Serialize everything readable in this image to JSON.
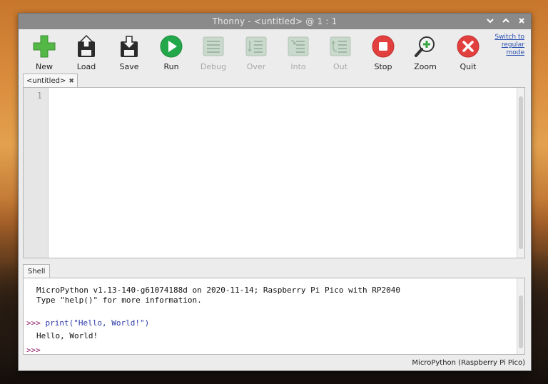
{
  "window": {
    "title": "Thonny  -  <untitled>  @  1 : 1",
    "controls": [
      "minimize",
      "maximize",
      "close"
    ]
  },
  "toolbar": {
    "buttons": [
      {
        "label": "New",
        "icon": "new-file-icon",
        "enabled": true
      },
      {
        "label": "Load",
        "icon": "load-icon",
        "enabled": true
      },
      {
        "label": "Save",
        "icon": "save-icon",
        "enabled": true
      },
      {
        "label": "Run",
        "icon": "run-icon",
        "enabled": true
      },
      {
        "label": "Debug",
        "icon": "debug-icon",
        "enabled": false
      },
      {
        "label": "Over",
        "icon": "step-over-icon",
        "enabled": false
      },
      {
        "label": "Into",
        "icon": "step-into-icon",
        "enabled": false
      },
      {
        "label": "Out",
        "icon": "step-out-icon",
        "enabled": false
      },
      {
        "label": "Stop",
        "icon": "stop-icon",
        "enabled": true
      },
      {
        "label": "Zoom",
        "icon": "zoom-icon",
        "enabled": true
      },
      {
        "label": "Quit",
        "icon": "quit-icon",
        "enabled": true
      }
    ],
    "mode_link": "Switch to\nregular\nmode"
  },
  "editor": {
    "tab_label": "<untitled>",
    "line_numbers": [
      "1"
    ],
    "content": ""
  },
  "shell": {
    "tab_label": "Shell",
    "banner_line1": "MicroPython v1.13-140-g61074188d on 2020-11-14; Raspberry Pi Pico with RP2040",
    "banner_line2": "Type \"help()\" for more information.",
    "prompt": ">>>",
    "command": "print(\"Hello, World!\")",
    "output": "Hello, World!",
    "prompt2": ">>>"
  },
  "statusbar": {
    "interpreter": "MicroPython (Raspberry Pi Pico)"
  },
  "colors": {
    "run_green": "#22a84a",
    "stop_red": "#e23f3f",
    "quit_red": "#e23f3f",
    "new_green": "#53b845",
    "prompt_purple": "#8b1d66",
    "command_blue": "#2d3aa8"
  }
}
